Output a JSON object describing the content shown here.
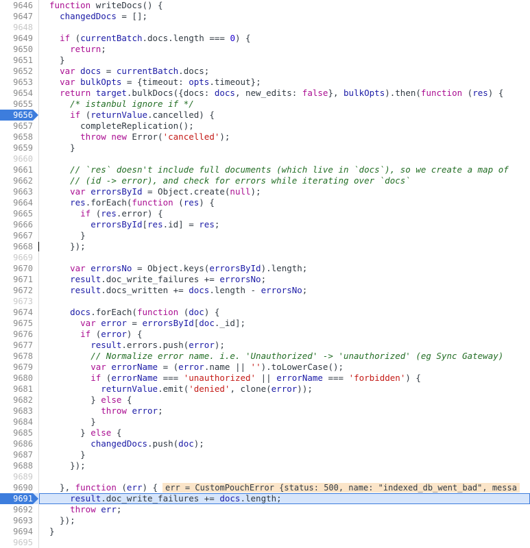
{
  "editor": {
    "lines": [
      {
        "num": "9646",
        "tokens": [
          {
            "t": "function ",
            "c": "k"
          },
          {
            "t": "writeDocs() {",
            "c": ""
          }
        ]
      },
      {
        "num": "9647",
        "tokens": [
          {
            "t": "  ",
            "c": ""
          },
          {
            "t": "changedDocs",
            "c": "v"
          },
          {
            "t": " = [];",
            "c": ""
          }
        ]
      },
      {
        "num": "9648",
        "dim": true,
        "tokens": []
      },
      {
        "num": "9649",
        "tokens": [
          {
            "t": "  ",
            "c": ""
          },
          {
            "t": "if",
            "c": "k"
          },
          {
            "t": " (",
            "c": ""
          },
          {
            "t": "currentBatch",
            "c": "v"
          },
          {
            "t": ".docs.length === ",
            "c": ""
          },
          {
            "t": "0",
            "c": "n"
          },
          {
            "t": ") {",
            "c": ""
          }
        ]
      },
      {
        "num": "9650",
        "tokens": [
          {
            "t": "    ",
            "c": ""
          },
          {
            "t": "return",
            "c": "k"
          },
          {
            "t": ";",
            "c": ""
          }
        ]
      },
      {
        "num": "9651",
        "tokens": [
          {
            "t": "  }",
            "c": ""
          }
        ]
      },
      {
        "num": "9652",
        "tokens": [
          {
            "t": "  ",
            "c": ""
          },
          {
            "t": "var",
            "c": "k"
          },
          {
            "t": " ",
            "c": ""
          },
          {
            "t": "docs",
            "c": "v"
          },
          {
            "t": " = ",
            "c": ""
          },
          {
            "t": "currentBatch",
            "c": "v"
          },
          {
            "t": ".docs;",
            "c": ""
          }
        ]
      },
      {
        "num": "9653",
        "tokens": [
          {
            "t": "  ",
            "c": ""
          },
          {
            "t": "var",
            "c": "k"
          },
          {
            "t": " ",
            "c": ""
          },
          {
            "t": "bulkOpts",
            "c": "v"
          },
          {
            "t": " = {timeout: ",
            "c": ""
          },
          {
            "t": "opts",
            "c": "v"
          },
          {
            "t": ".timeout};",
            "c": ""
          }
        ]
      },
      {
        "num": "9654",
        "tokens": [
          {
            "t": "  ",
            "c": ""
          },
          {
            "t": "return",
            "c": "k"
          },
          {
            "t": " ",
            "c": ""
          },
          {
            "t": "target",
            "c": "v"
          },
          {
            "t": ".bulkDocs({docs: ",
            "c": ""
          },
          {
            "t": "docs",
            "c": "v"
          },
          {
            "t": ", new_edits: ",
            "c": ""
          },
          {
            "t": "false",
            "c": "k"
          },
          {
            "t": "}, ",
            "c": ""
          },
          {
            "t": "bulkOpts",
            "c": "v"
          },
          {
            "t": ").then(",
            "c": ""
          },
          {
            "t": "function",
            "c": "k"
          },
          {
            "t": " (",
            "c": ""
          },
          {
            "t": "res",
            "c": "v"
          },
          {
            "t": ") {",
            "c": ""
          }
        ]
      },
      {
        "num": "9655",
        "tokens": [
          {
            "t": "    ",
            "c": ""
          },
          {
            "t": "/* istanbul ignore if */",
            "c": "c"
          }
        ]
      },
      {
        "num": "9656",
        "bp": true,
        "tokens": [
          {
            "t": "    ",
            "c": ""
          },
          {
            "t": "if",
            "c": "k"
          },
          {
            "t": " (",
            "c": ""
          },
          {
            "t": "returnValue",
            "c": "v"
          },
          {
            "t": ".cancelled) {",
            "c": ""
          }
        ]
      },
      {
        "num": "9657",
        "tokens": [
          {
            "t": "      completeReplication();",
            "c": ""
          }
        ]
      },
      {
        "num": "9658",
        "tokens": [
          {
            "t": "      ",
            "c": ""
          },
          {
            "t": "throw",
            "c": "k"
          },
          {
            "t": " ",
            "c": ""
          },
          {
            "t": "new",
            "c": "k"
          },
          {
            "t": " Error(",
            "c": ""
          },
          {
            "t": "'cancelled'",
            "c": "s"
          },
          {
            "t": ");",
            "c": ""
          }
        ]
      },
      {
        "num": "9659",
        "tokens": [
          {
            "t": "    }",
            "c": ""
          }
        ]
      },
      {
        "num": "9660",
        "dim": true,
        "tokens": []
      },
      {
        "num": "9661",
        "tokens": [
          {
            "t": "    ",
            "c": ""
          },
          {
            "t": "// `res` doesn't include full documents (which live in `docs`), so we create a map of",
            "c": "c"
          }
        ]
      },
      {
        "num": "9662",
        "tokens": [
          {
            "t": "    ",
            "c": ""
          },
          {
            "t": "// (id -> error), and check for errors while iterating over `docs`",
            "c": "c"
          }
        ]
      },
      {
        "num": "9663",
        "tokens": [
          {
            "t": "    ",
            "c": ""
          },
          {
            "t": "var",
            "c": "k"
          },
          {
            "t": " ",
            "c": ""
          },
          {
            "t": "errorsById",
            "c": "v"
          },
          {
            "t": " = Object.create(",
            "c": ""
          },
          {
            "t": "null",
            "c": "k"
          },
          {
            "t": ");",
            "c": ""
          }
        ]
      },
      {
        "num": "9664",
        "tokens": [
          {
            "t": "    ",
            "c": ""
          },
          {
            "t": "res",
            "c": "v"
          },
          {
            "t": ".forEach(",
            "c": ""
          },
          {
            "t": "function",
            "c": "k"
          },
          {
            "t": " (",
            "c": ""
          },
          {
            "t": "res",
            "c": "v"
          },
          {
            "t": ") {",
            "c": ""
          }
        ]
      },
      {
        "num": "9665",
        "tokens": [
          {
            "t": "      ",
            "c": ""
          },
          {
            "t": "if",
            "c": "k"
          },
          {
            "t": " (",
            "c": ""
          },
          {
            "t": "res",
            "c": "v"
          },
          {
            "t": ".error) {",
            "c": ""
          }
        ]
      },
      {
        "num": "9666",
        "tokens": [
          {
            "t": "        ",
            "c": ""
          },
          {
            "t": "errorsById",
            "c": "v"
          },
          {
            "t": "[",
            "c": ""
          },
          {
            "t": "res",
            "c": "v"
          },
          {
            "t": ".id] = ",
            "c": ""
          },
          {
            "t": "res",
            "c": "v"
          },
          {
            "t": ";",
            "c": ""
          }
        ]
      },
      {
        "num": "9667",
        "tokens": [
          {
            "t": "      }",
            "c": ""
          }
        ]
      },
      {
        "num": "9668",
        "caret": true,
        "tokens": [
          {
            "t": "    });",
            "c": ""
          }
        ]
      },
      {
        "num": "9669",
        "dim": true,
        "tokens": []
      },
      {
        "num": "9670",
        "tokens": [
          {
            "t": "    ",
            "c": ""
          },
          {
            "t": "var",
            "c": "k"
          },
          {
            "t": " ",
            "c": ""
          },
          {
            "t": "errorsNo",
            "c": "v"
          },
          {
            "t": " = Object.keys(",
            "c": ""
          },
          {
            "t": "errorsById",
            "c": "v"
          },
          {
            "t": ").length;",
            "c": ""
          }
        ]
      },
      {
        "num": "9671",
        "tokens": [
          {
            "t": "    ",
            "c": ""
          },
          {
            "t": "result",
            "c": "v"
          },
          {
            "t": ".doc_write_failures += ",
            "c": ""
          },
          {
            "t": "errorsNo",
            "c": "v"
          },
          {
            "t": ";",
            "c": ""
          }
        ]
      },
      {
        "num": "9672",
        "tokens": [
          {
            "t": "    ",
            "c": ""
          },
          {
            "t": "result",
            "c": "v"
          },
          {
            "t": ".docs_written += ",
            "c": ""
          },
          {
            "t": "docs",
            "c": "v"
          },
          {
            "t": ".length - ",
            "c": ""
          },
          {
            "t": "errorsNo",
            "c": "v"
          },
          {
            "t": ";",
            "c": ""
          }
        ]
      },
      {
        "num": "9673",
        "dim": true,
        "tokens": []
      },
      {
        "num": "9674",
        "tokens": [
          {
            "t": "    ",
            "c": ""
          },
          {
            "t": "docs",
            "c": "v"
          },
          {
            "t": ".forEach(",
            "c": ""
          },
          {
            "t": "function",
            "c": "k"
          },
          {
            "t": " (",
            "c": ""
          },
          {
            "t": "doc",
            "c": "v"
          },
          {
            "t": ") {",
            "c": ""
          }
        ]
      },
      {
        "num": "9675",
        "tokens": [
          {
            "t": "      ",
            "c": ""
          },
          {
            "t": "var",
            "c": "k"
          },
          {
            "t": " ",
            "c": ""
          },
          {
            "t": "error",
            "c": "v"
          },
          {
            "t": " = ",
            "c": ""
          },
          {
            "t": "errorsById",
            "c": "v"
          },
          {
            "t": "[",
            "c": ""
          },
          {
            "t": "doc",
            "c": "v"
          },
          {
            "t": "._id];",
            "c": ""
          }
        ]
      },
      {
        "num": "9676",
        "tokens": [
          {
            "t": "      ",
            "c": ""
          },
          {
            "t": "if",
            "c": "k"
          },
          {
            "t": " (",
            "c": ""
          },
          {
            "t": "error",
            "c": "v"
          },
          {
            "t": ") {",
            "c": ""
          }
        ]
      },
      {
        "num": "9677",
        "tokens": [
          {
            "t": "        ",
            "c": ""
          },
          {
            "t": "result",
            "c": "v"
          },
          {
            "t": ".errors.push(",
            "c": ""
          },
          {
            "t": "error",
            "c": "v"
          },
          {
            "t": ");",
            "c": ""
          }
        ]
      },
      {
        "num": "9678",
        "tokens": [
          {
            "t": "        ",
            "c": ""
          },
          {
            "t": "// Normalize error name. i.e. 'Unauthorized' -> 'unauthorized' (eg Sync Gateway)",
            "c": "c"
          }
        ]
      },
      {
        "num": "9679",
        "tokens": [
          {
            "t": "        ",
            "c": ""
          },
          {
            "t": "var",
            "c": "k"
          },
          {
            "t": " ",
            "c": ""
          },
          {
            "t": "errorName",
            "c": "v"
          },
          {
            "t": " = (",
            "c": ""
          },
          {
            "t": "error",
            "c": "v"
          },
          {
            "t": ".name || ",
            "c": ""
          },
          {
            "t": "''",
            "c": "s"
          },
          {
            "t": ").toLowerCase();",
            "c": ""
          }
        ]
      },
      {
        "num": "9680",
        "tokens": [
          {
            "t": "        ",
            "c": ""
          },
          {
            "t": "if",
            "c": "k"
          },
          {
            "t": " (",
            "c": ""
          },
          {
            "t": "errorName",
            "c": "v"
          },
          {
            "t": " === ",
            "c": ""
          },
          {
            "t": "'unauthorized'",
            "c": "s"
          },
          {
            "t": " || ",
            "c": ""
          },
          {
            "t": "errorName",
            "c": "v"
          },
          {
            "t": " === ",
            "c": ""
          },
          {
            "t": "'forbidden'",
            "c": "s"
          },
          {
            "t": ") {",
            "c": ""
          }
        ]
      },
      {
        "num": "9681",
        "tokens": [
          {
            "t": "          ",
            "c": ""
          },
          {
            "t": "returnValue",
            "c": "v"
          },
          {
            "t": ".emit(",
            "c": ""
          },
          {
            "t": "'denied'",
            "c": "s"
          },
          {
            "t": ", clone(",
            "c": ""
          },
          {
            "t": "error",
            "c": "v"
          },
          {
            "t": "));",
            "c": ""
          }
        ]
      },
      {
        "num": "9682",
        "tokens": [
          {
            "t": "        } ",
            "c": ""
          },
          {
            "t": "else",
            "c": "k"
          },
          {
            "t": " {",
            "c": ""
          }
        ]
      },
      {
        "num": "9683",
        "tokens": [
          {
            "t": "          ",
            "c": ""
          },
          {
            "t": "throw",
            "c": "k"
          },
          {
            "t": " ",
            "c": ""
          },
          {
            "t": "error",
            "c": "v"
          },
          {
            "t": ";",
            "c": ""
          }
        ]
      },
      {
        "num": "9684",
        "tokens": [
          {
            "t": "        }",
            "c": ""
          }
        ]
      },
      {
        "num": "9685",
        "tokens": [
          {
            "t": "      } ",
            "c": ""
          },
          {
            "t": "else",
            "c": "k"
          },
          {
            "t": " {",
            "c": ""
          }
        ]
      },
      {
        "num": "9686",
        "tokens": [
          {
            "t": "        ",
            "c": ""
          },
          {
            "t": "changedDocs",
            "c": "v"
          },
          {
            "t": ".push(",
            "c": ""
          },
          {
            "t": "doc",
            "c": "v"
          },
          {
            "t": ");",
            "c": ""
          }
        ]
      },
      {
        "num": "9687",
        "tokens": [
          {
            "t": "      }",
            "c": ""
          }
        ]
      },
      {
        "num": "9688",
        "tokens": [
          {
            "t": "    });",
            "c": ""
          }
        ]
      },
      {
        "num": "9689",
        "dim": true,
        "tokens": []
      },
      {
        "num": "9690",
        "inline": true,
        "tokens": [
          {
            "t": "  }, ",
            "c": ""
          },
          {
            "t": "function",
            "c": "k"
          },
          {
            "t": " (",
            "c": ""
          },
          {
            "t": "err",
            "c": "v"
          },
          {
            "t": ") {",
            "c": ""
          }
        ]
      },
      {
        "num": "9691",
        "current": true,
        "tokens": [
          {
            "t": "    ",
            "c": ""
          },
          {
            "t": "result",
            "c": "v"
          },
          {
            "t": ".doc_write_failures += ",
            "c": ""
          },
          {
            "t": "docs",
            "c": "v"
          },
          {
            "t": ".length;",
            "c": ""
          }
        ]
      },
      {
        "num": "9692",
        "tokens": [
          {
            "t": "    ",
            "c": ""
          },
          {
            "t": "throw",
            "c": "k"
          },
          {
            "t": " ",
            "c": ""
          },
          {
            "t": "err",
            "c": "v"
          },
          {
            "t": ";",
            "c": ""
          }
        ]
      },
      {
        "num": "9693",
        "tokens": [
          {
            "t": "  });",
            "c": ""
          }
        ]
      },
      {
        "num": "9694",
        "tokens": [
          {
            "t": "}",
            "c": ""
          }
        ]
      },
      {
        "num": "9695",
        "dim": true,
        "tokens": []
      }
    ],
    "inline_value": "err = CustomPouchError {status: 500, name: \"indexed_db_went_bad\", messa"
  },
  "colors": {
    "keyword": "#aa0d91",
    "string": "#c41a16",
    "number": "#1c00cf",
    "comment": "#236e25",
    "variable": "#1a1aa6",
    "breakpoint": "#3d7ddd",
    "current_line": "#d6e5fb",
    "inline_value_bg": "#fbe5c9"
  }
}
